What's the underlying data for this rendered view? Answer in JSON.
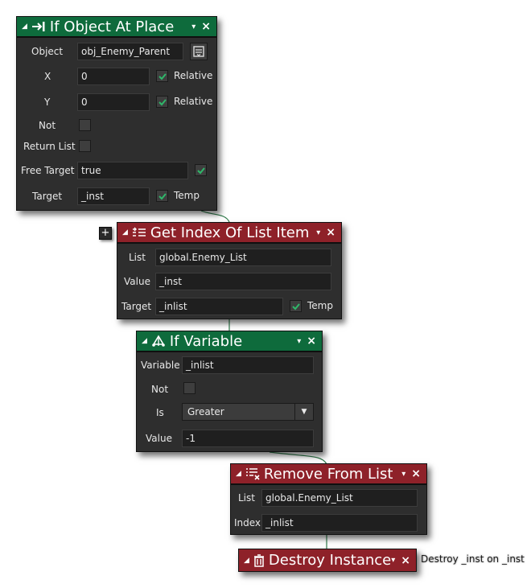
{
  "nodes": {
    "if_object_at_place": {
      "title": "If Object At Place",
      "icon": "arrow-to-bar-icon",
      "color": "#0e6b3c",
      "fields": {
        "object_label": "Object",
        "object_value": "obj_Enemy_Parent",
        "x_label": "X",
        "x_value": "0",
        "x_relative": "Relative",
        "x_relative_checked": true,
        "y_label": "Y",
        "y_value": "0",
        "y_relative": "Relative",
        "y_relative_checked": true,
        "not_label": "Not",
        "not_checked": false,
        "return_list_label": "Return List",
        "return_list_checked": false,
        "free_target_label": "Free Target",
        "free_target_value": "true",
        "free_target_checked": true,
        "target_label": "Target",
        "target_value": "_inst",
        "temp_label": "Temp",
        "temp_checked": true
      }
    },
    "get_index_of_list_item": {
      "title": "Get Index Of List Item",
      "icon": "list-arrow-icon",
      "color": "#8e2129",
      "fields": {
        "list_label": "List",
        "list_value": "global.Enemy_List",
        "value_label": "Value",
        "value_value": "_inst",
        "target_label": "Target",
        "target_value": "_inlist",
        "temp_label": "Temp",
        "temp_checked": true
      }
    },
    "if_variable": {
      "title": "If Variable",
      "icon": "branch-icon",
      "color": "#0e6b3c",
      "fields": {
        "variable_label": "Variable",
        "variable_value": "_inlist",
        "not_label": "Not",
        "not_checked": false,
        "is_label": "Is",
        "is_value": "Greater",
        "value_label": "Value",
        "value_value": "-1"
      }
    },
    "remove_from_list": {
      "title": "Remove From List",
      "icon": "list-remove-icon",
      "color": "#8e2129",
      "fields": {
        "list_label": "List",
        "list_value": "global.Enemy_List",
        "index_label": "Index",
        "index_value": "_inlist"
      }
    },
    "destroy_instance": {
      "title": "Destroy Instance",
      "icon": "trash-icon",
      "color": "#8e2129",
      "annotation": "Destroy _inst on _inst"
    }
  },
  "controls": {
    "dropdown_glyph": "▾",
    "close_glyph": "×",
    "collapse_glyph": "◢",
    "add_glyph": "+"
  }
}
